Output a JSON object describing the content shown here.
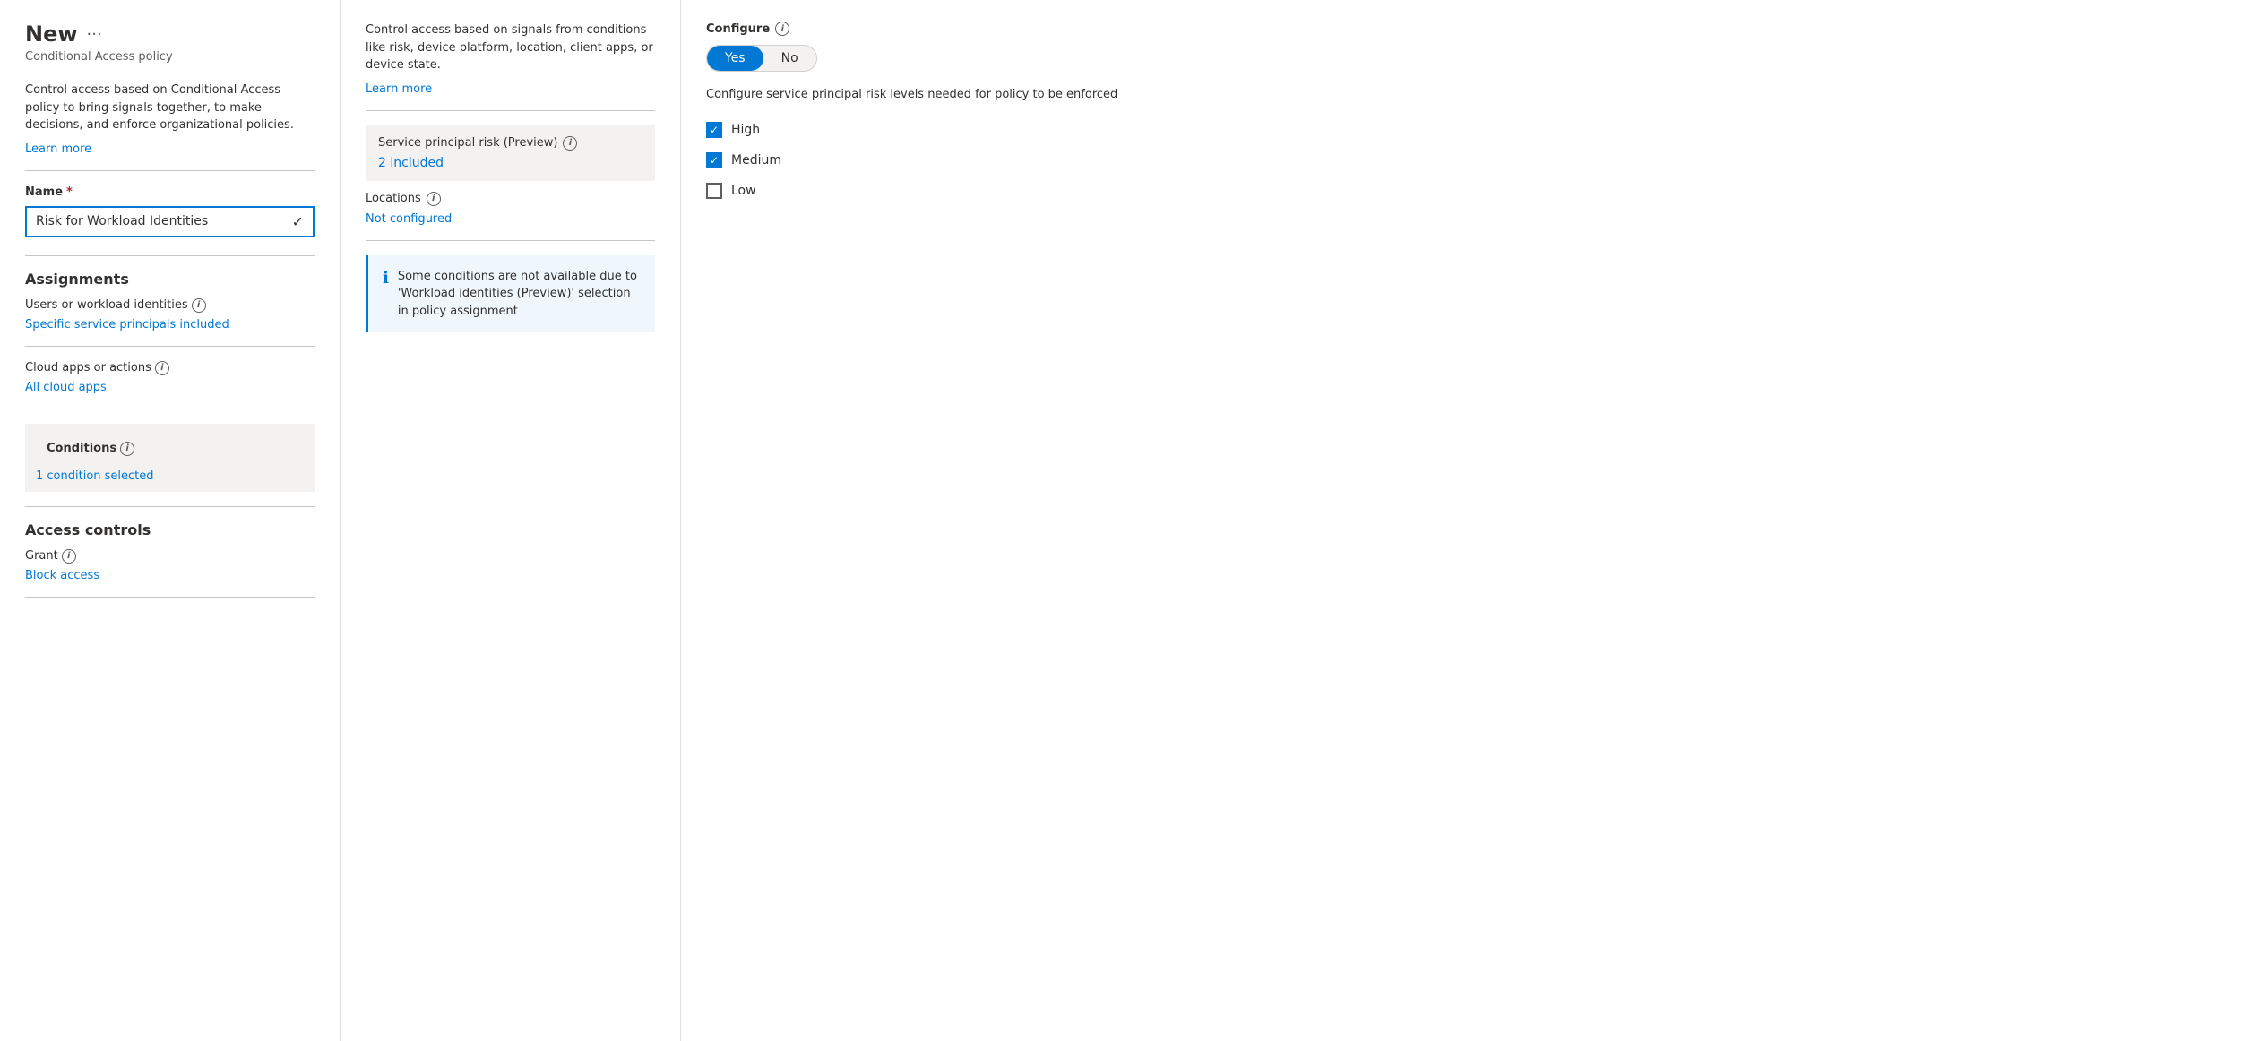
{
  "mainPanel": {
    "title": "New",
    "ellipsis": "···",
    "subtitle": "Conditional Access policy",
    "description": "Control access based on Conditional Access policy to bring signals together, to make decisions, and enforce organizational policies.",
    "learnMoreLabel": "Learn more",
    "nameLabel": "Name",
    "nameValue": "Risk for Workload Identities",
    "assignmentsTitle": "Assignments",
    "usersLabel": "Users or workload identities",
    "usersValue": "Specific service principals included",
    "cloudAppsLabel": "Cloud apps or actions",
    "cloudAppsValue": "All cloud apps",
    "conditionsTitle": "Conditions",
    "conditionValue": "1 condition selected",
    "accessControlsTitle": "Access controls",
    "grantLabel": "Grant",
    "grantValue": "Block access"
  },
  "middlePanel": {
    "description": "Control access based on signals from conditions like risk, device platform, location, client apps, or device state.",
    "learnMoreLabel": "Learn more",
    "servicePrincipalLabel": "Service principal risk (Preview)",
    "servicePrincipalValue": "2 included",
    "locationsLabel": "Locations",
    "locationsValue": "Not configured",
    "infoBoxText": "Some conditions are not available due to 'Workload identities (Preview)' selection in policy assignment"
  },
  "rightPanel": {
    "configureLabel": "Configure",
    "yesLabel": "Yes",
    "noLabel": "No",
    "description": "Configure service principal risk levels needed for policy to be enforced",
    "checkboxes": [
      {
        "label": "High",
        "checked": true
      },
      {
        "label": "Medium",
        "checked": true
      },
      {
        "label": "Low",
        "checked": false
      }
    ]
  }
}
